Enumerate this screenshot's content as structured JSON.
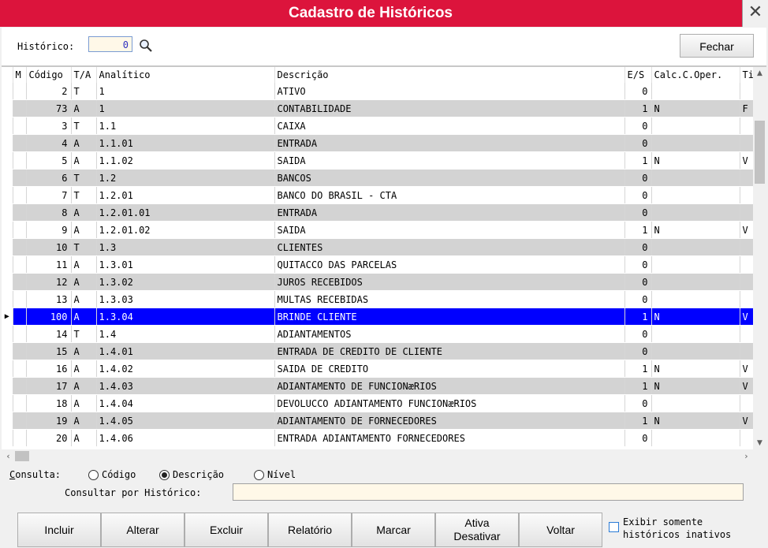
{
  "window": {
    "title": "Cadastro de Históricos",
    "close_glyph": "✕"
  },
  "filter": {
    "label": "Histórico:",
    "value": "0",
    "close_label": "Fechar"
  },
  "grid": {
    "columns": [
      "M",
      "Código",
      "T/A",
      "Analítico",
      "Descrição",
      "E/S",
      "Calc.C.Oper.",
      "Ti"
    ],
    "selected_index": 13,
    "rows": [
      {
        "codigo": "2",
        "ta": "T",
        "analitico": "1",
        "descricao": "ATIVO",
        "es": "0",
        "calc": "",
        "ti": ""
      },
      {
        "codigo": "73",
        "ta": "A",
        "analitico": "1",
        "descricao": "CONTABILIDADE",
        "es": "1",
        "calc": "N",
        "ti": "F"
      },
      {
        "codigo": "3",
        "ta": "T",
        "analitico": "1.1",
        "descricao": "CAIXA",
        "es": "0",
        "calc": "",
        "ti": ""
      },
      {
        "codigo": "4",
        "ta": "A",
        "analitico": "1.1.01",
        "descricao": "ENTRADA",
        "es": "0",
        "calc": "",
        "ti": ""
      },
      {
        "codigo": "5",
        "ta": "A",
        "analitico": "1.1.02",
        "descricao": "SAIDA",
        "es": "1",
        "calc": "N",
        "ti": "V"
      },
      {
        "codigo": "6",
        "ta": "T",
        "analitico": "1.2",
        "descricao": "BANCOS",
        "es": "0",
        "calc": "",
        "ti": ""
      },
      {
        "codigo": "7",
        "ta": "T",
        "analitico": "1.2.01",
        "descricao": "BANCO DO BRASIL - CTA",
        "es": "0",
        "calc": "",
        "ti": ""
      },
      {
        "codigo": "8",
        "ta": "A",
        "analitico": "1.2.01.01",
        "descricao": "ENTRADA",
        "es": "0",
        "calc": "",
        "ti": ""
      },
      {
        "codigo": "9",
        "ta": "A",
        "analitico": "1.2.01.02",
        "descricao": "SAIDA",
        "es": "1",
        "calc": "N",
        "ti": "V"
      },
      {
        "codigo": "10",
        "ta": "T",
        "analitico": "1.3",
        "descricao": "CLIENTES",
        "es": "0",
        "calc": "",
        "ti": ""
      },
      {
        "codigo": "11",
        "ta": "A",
        "analitico": "1.3.01",
        "descricao": "QUITACCO DAS PARCELAS",
        "es": "0",
        "calc": "",
        "ti": ""
      },
      {
        "codigo": "12",
        "ta": "A",
        "analitico": "1.3.02",
        "descricao": "JUROS RECEBIDOS",
        "es": "0",
        "calc": "",
        "ti": ""
      },
      {
        "codigo": "13",
        "ta": "A",
        "analitico": "1.3.03",
        "descricao": "MULTAS RECEBIDAS",
        "es": "0",
        "calc": "",
        "ti": ""
      },
      {
        "codigo": "100",
        "ta": "A",
        "analitico": "1.3.04",
        "descricao": "BRINDE CLIENTE",
        "es": "1",
        "calc": "N",
        "ti": "V"
      },
      {
        "codigo": "14",
        "ta": "T",
        "analitico": "1.4",
        "descricao": "ADIANTAMENTOS",
        "es": "0",
        "calc": "",
        "ti": ""
      },
      {
        "codigo": "15",
        "ta": "A",
        "analitico": "1.4.01",
        "descricao": "ENTRADA DE CREDITO DE CLIENTE",
        "es": "0",
        "calc": "",
        "ti": ""
      },
      {
        "codigo": "16",
        "ta": "A",
        "analitico": "1.4.02",
        "descricao": "SAIDA DE CREDITO",
        "es": "1",
        "calc": "N",
        "ti": "V"
      },
      {
        "codigo": "17",
        "ta": "A",
        "analitico": "1.4.03",
        "descricao": "ADIANTAMENTO DE FUNCIONæRIOS",
        "es": "1",
        "calc": "N",
        "ti": "V"
      },
      {
        "codigo": "18",
        "ta": "A",
        "analitico": "1.4.04",
        "descricao": "DEVOLUCCO ADIANTAMENTO FUNCIONæRIOS",
        "es": "0",
        "calc": "",
        "ti": ""
      },
      {
        "codigo": "19",
        "ta": "A",
        "analitico": "1.4.05",
        "descricao": "ADIANTAMENTO DE FORNECEDORES",
        "es": "1",
        "calc": "N",
        "ti": "V"
      },
      {
        "codigo": "20",
        "ta": "A",
        "analitico": "1.4.06",
        "descricao": "ENTRADA ADIANTAMENTO FORNECEDORES",
        "es": "0",
        "calc": "",
        "ti": ""
      }
    ]
  },
  "consulta": {
    "label": "Consulta:",
    "options": [
      {
        "label": "Código",
        "selected": false
      },
      {
        "label": "Descrição",
        "selected": true
      },
      {
        "label": "Nível",
        "selected": false
      }
    ],
    "query_label": "Consultar por Histórico:",
    "query_value": ""
  },
  "actions": [
    "Incluir",
    "Alterar",
    "Excluir",
    "Relatório",
    "Marcar",
    "Ativa\nDesativar",
    "Voltar"
  ],
  "inactive_checkbox": {
    "label": "Exibir somente\nhistóricos inativos",
    "checked": false
  }
}
